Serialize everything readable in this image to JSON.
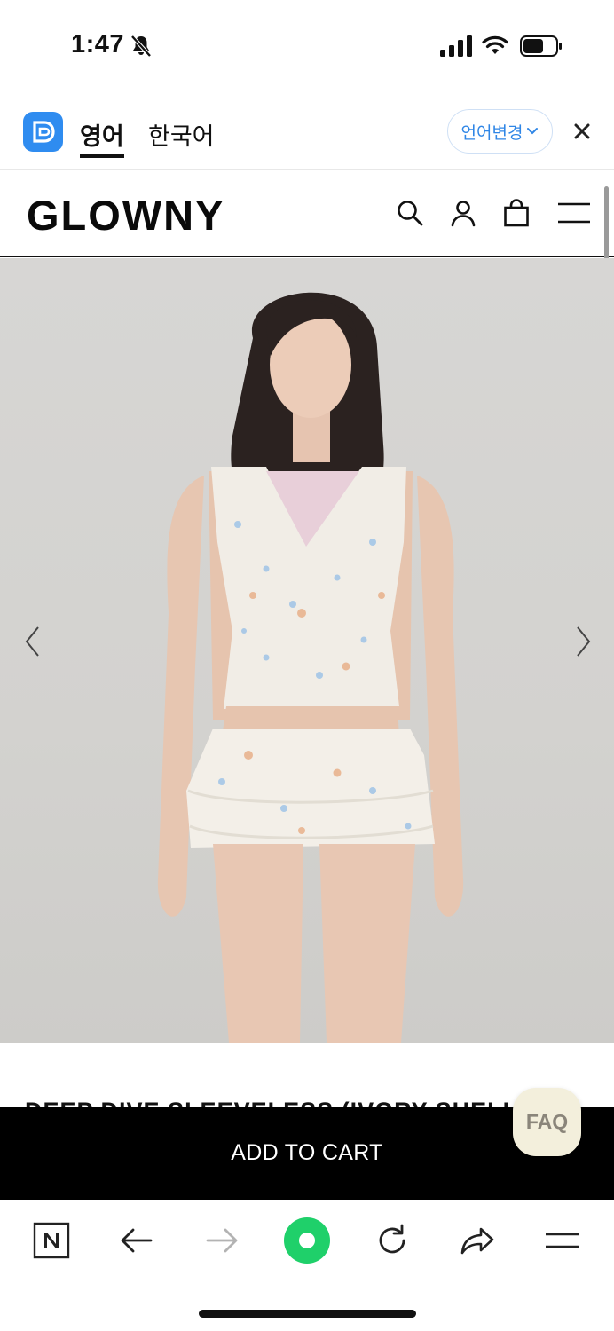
{
  "status_bar": {
    "time": "1:47"
  },
  "translate_bar": {
    "tabs": [
      {
        "label": "영어",
        "active": true
      },
      {
        "label": "한국어",
        "active": false
      }
    ],
    "change_language_label": "언어변경",
    "accent_color": "#2f86e6"
  },
  "site_header": {
    "logo": "GLOWNY",
    "icons": [
      "search-icon",
      "user-icon",
      "bag-icon",
      "menu-icon"
    ]
  },
  "product": {
    "title": "DEEP DIVE SLEEVELESS (IVORY SHELL)",
    "add_to_cart_label": "ADD TO CART"
  },
  "faq": {
    "label": "FAQ"
  },
  "browser_toolbar": {
    "icons": [
      "naver-icon",
      "back-icon",
      "forward-icon",
      "green-circle-icon",
      "reload-icon",
      "share-icon",
      "menu-icon"
    ]
  }
}
